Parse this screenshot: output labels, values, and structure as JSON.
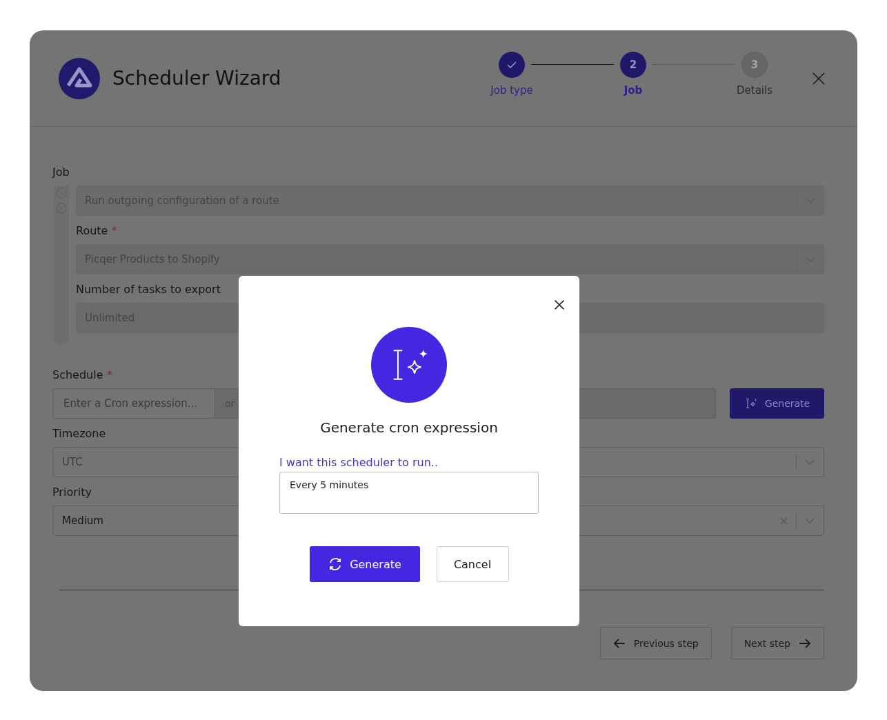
{
  "window": {
    "title": "Scheduler Wizard"
  },
  "steps": [
    {
      "label": "Job type",
      "completed": true,
      "selected": false
    },
    {
      "label": "Job",
      "number": "2",
      "completed": false,
      "selected": true
    },
    {
      "label": "Details",
      "number": "3",
      "completed": false,
      "selected": false
    }
  ],
  "job": {
    "label": "Job",
    "value": "Run outgoing configuration of a route",
    "fields": [
      {
        "label": "Route",
        "required_mark": "*",
        "value": "Picqer Products to Shopify",
        "kind": "select"
      },
      {
        "label": "Number of tasks to export",
        "value": "Unlimited",
        "kind": "input"
      }
    ]
  },
  "schedule": {
    "label": "Schedule",
    "required_mark": "*",
    "placeholder": "Enter a Cron expression...",
    "addon": "or",
    "button": "Generate"
  },
  "fields": [
    {
      "label": "Timezone",
      "value": "UTC",
      "clearable": false,
      "muted": true
    },
    {
      "label": "Priority",
      "value": "Medium",
      "clearable": true,
      "muted": false
    }
  ],
  "footer": {
    "previous": "Previous step",
    "next": "Next step"
  },
  "modal": {
    "title": "Generate cron expression",
    "prompt_label": "I want this scheduler to run..",
    "prompt_value": "Every 5 minutes",
    "generate": "Generate",
    "cancel": "Cancel"
  }
}
